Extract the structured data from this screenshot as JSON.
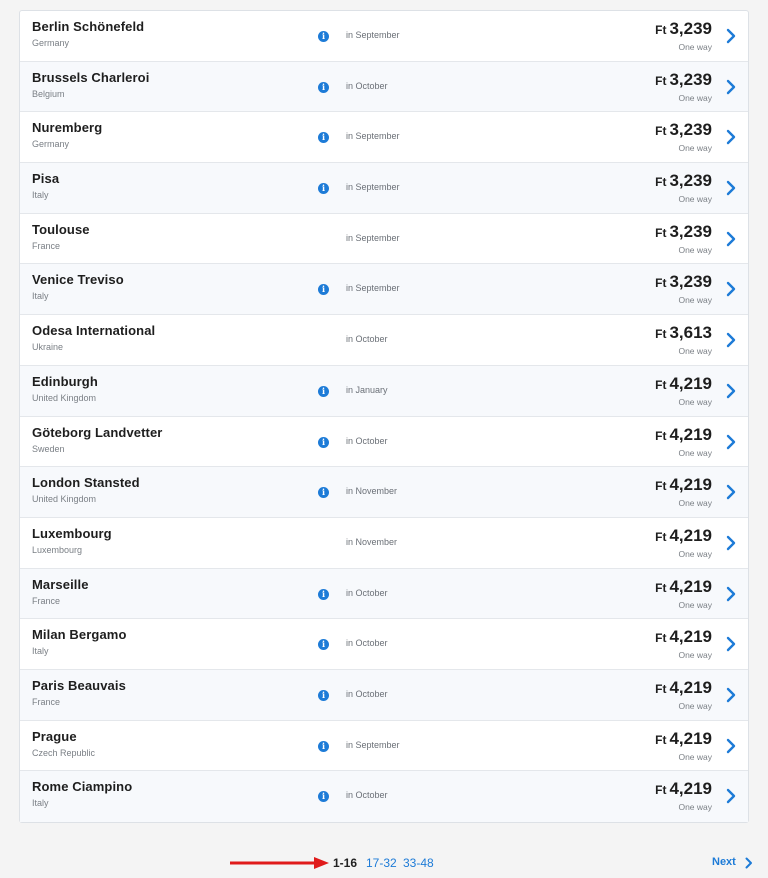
{
  "currency": "Ft",
  "one_way_label": "One way",
  "accent_color": "#1d7bd7",
  "flights": [
    {
      "city": "Berlin Schönefeld",
      "country": "Germany",
      "info": true,
      "month": "in September",
      "price": "3,239"
    },
    {
      "city": "Brussels Charleroi",
      "country": "Belgium",
      "info": true,
      "month": "in October",
      "price": "3,239"
    },
    {
      "city": "Nuremberg",
      "country": "Germany",
      "info": true,
      "month": "in September",
      "price": "3,239"
    },
    {
      "city": "Pisa",
      "country": "Italy",
      "info": true,
      "month": "in September",
      "price": "3,239"
    },
    {
      "city": "Toulouse",
      "country": "France",
      "info": false,
      "month": "in September",
      "price": "3,239"
    },
    {
      "city": "Venice Treviso",
      "country": "Italy",
      "info": true,
      "month": "in September",
      "price": "3,239"
    },
    {
      "city": "Odesa International",
      "country": "Ukraine",
      "info": false,
      "month": "in October",
      "price": "3,613"
    },
    {
      "city": "Edinburgh",
      "country": "United Kingdom",
      "info": true,
      "month": "in January",
      "price": "4,219"
    },
    {
      "city": "Göteborg Landvetter",
      "country": "Sweden",
      "info": true,
      "month": "in October",
      "price": "4,219"
    },
    {
      "city": "London Stansted",
      "country": "United Kingdom",
      "info": true,
      "month": "in November",
      "price": "4,219"
    },
    {
      "city": "Luxembourg",
      "country": "Luxembourg",
      "info": false,
      "month": "in November",
      "price": "4,219"
    },
    {
      "city": "Marseille",
      "country": "France",
      "info": true,
      "month": "in October",
      "price": "4,219"
    },
    {
      "city": "Milan Bergamo",
      "country": "Italy",
      "info": true,
      "month": "in October",
      "price": "4,219"
    },
    {
      "city": "Paris Beauvais",
      "country": "France",
      "info": true,
      "month": "in October",
      "price": "4,219"
    },
    {
      "city": "Prague",
      "country": "Czech Republic",
      "info": true,
      "month": "in September",
      "price": "4,219"
    },
    {
      "city": "Rome Ciampino",
      "country": "Italy",
      "info": true,
      "month": "in October",
      "price": "4,219"
    }
  ],
  "pagination": {
    "current": "1-16",
    "pages": [
      "17-32",
      "33-48"
    ],
    "next_label": "Next"
  }
}
